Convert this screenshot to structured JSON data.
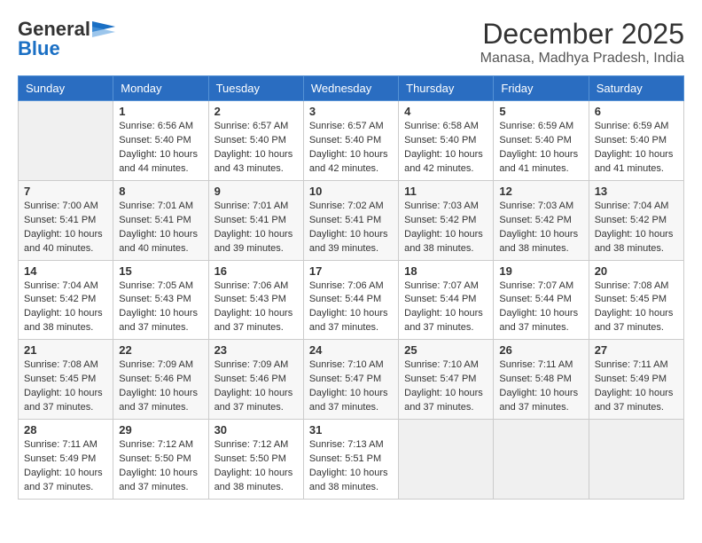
{
  "header": {
    "logo_general": "General",
    "logo_blue": "Blue",
    "title": "December 2025",
    "location": "Manasa, Madhya Pradesh, India"
  },
  "weekdays": [
    "Sunday",
    "Monday",
    "Tuesday",
    "Wednesday",
    "Thursday",
    "Friday",
    "Saturday"
  ],
  "weeks": [
    [
      {
        "day": "",
        "info": ""
      },
      {
        "day": "1",
        "info": "Sunrise: 6:56 AM\nSunset: 5:40 PM\nDaylight: 10 hours\nand 44 minutes."
      },
      {
        "day": "2",
        "info": "Sunrise: 6:57 AM\nSunset: 5:40 PM\nDaylight: 10 hours\nand 43 minutes."
      },
      {
        "day": "3",
        "info": "Sunrise: 6:57 AM\nSunset: 5:40 PM\nDaylight: 10 hours\nand 42 minutes."
      },
      {
        "day": "4",
        "info": "Sunrise: 6:58 AM\nSunset: 5:40 PM\nDaylight: 10 hours\nand 42 minutes."
      },
      {
        "day": "5",
        "info": "Sunrise: 6:59 AM\nSunset: 5:40 PM\nDaylight: 10 hours\nand 41 minutes."
      },
      {
        "day": "6",
        "info": "Sunrise: 6:59 AM\nSunset: 5:40 PM\nDaylight: 10 hours\nand 41 minutes."
      }
    ],
    [
      {
        "day": "7",
        "info": "Sunrise: 7:00 AM\nSunset: 5:41 PM\nDaylight: 10 hours\nand 40 minutes."
      },
      {
        "day": "8",
        "info": "Sunrise: 7:01 AM\nSunset: 5:41 PM\nDaylight: 10 hours\nand 40 minutes."
      },
      {
        "day": "9",
        "info": "Sunrise: 7:01 AM\nSunset: 5:41 PM\nDaylight: 10 hours\nand 39 minutes."
      },
      {
        "day": "10",
        "info": "Sunrise: 7:02 AM\nSunset: 5:41 PM\nDaylight: 10 hours\nand 39 minutes."
      },
      {
        "day": "11",
        "info": "Sunrise: 7:03 AM\nSunset: 5:42 PM\nDaylight: 10 hours\nand 38 minutes."
      },
      {
        "day": "12",
        "info": "Sunrise: 7:03 AM\nSunset: 5:42 PM\nDaylight: 10 hours\nand 38 minutes."
      },
      {
        "day": "13",
        "info": "Sunrise: 7:04 AM\nSunset: 5:42 PM\nDaylight: 10 hours\nand 38 minutes."
      }
    ],
    [
      {
        "day": "14",
        "info": "Sunrise: 7:04 AM\nSunset: 5:42 PM\nDaylight: 10 hours\nand 38 minutes."
      },
      {
        "day": "15",
        "info": "Sunrise: 7:05 AM\nSunset: 5:43 PM\nDaylight: 10 hours\nand 37 minutes."
      },
      {
        "day": "16",
        "info": "Sunrise: 7:06 AM\nSunset: 5:43 PM\nDaylight: 10 hours\nand 37 minutes."
      },
      {
        "day": "17",
        "info": "Sunrise: 7:06 AM\nSunset: 5:44 PM\nDaylight: 10 hours\nand 37 minutes."
      },
      {
        "day": "18",
        "info": "Sunrise: 7:07 AM\nSunset: 5:44 PM\nDaylight: 10 hours\nand 37 minutes."
      },
      {
        "day": "19",
        "info": "Sunrise: 7:07 AM\nSunset: 5:44 PM\nDaylight: 10 hours\nand 37 minutes."
      },
      {
        "day": "20",
        "info": "Sunrise: 7:08 AM\nSunset: 5:45 PM\nDaylight: 10 hours\nand 37 minutes."
      }
    ],
    [
      {
        "day": "21",
        "info": "Sunrise: 7:08 AM\nSunset: 5:45 PM\nDaylight: 10 hours\nand 37 minutes."
      },
      {
        "day": "22",
        "info": "Sunrise: 7:09 AM\nSunset: 5:46 PM\nDaylight: 10 hours\nand 37 minutes."
      },
      {
        "day": "23",
        "info": "Sunrise: 7:09 AM\nSunset: 5:46 PM\nDaylight: 10 hours\nand 37 minutes."
      },
      {
        "day": "24",
        "info": "Sunrise: 7:10 AM\nSunset: 5:47 PM\nDaylight: 10 hours\nand 37 minutes."
      },
      {
        "day": "25",
        "info": "Sunrise: 7:10 AM\nSunset: 5:47 PM\nDaylight: 10 hours\nand 37 minutes."
      },
      {
        "day": "26",
        "info": "Sunrise: 7:11 AM\nSunset: 5:48 PM\nDaylight: 10 hours\nand 37 minutes."
      },
      {
        "day": "27",
        "info": "Sunrise: 7:11 AM\nSunset: 5:49 PM\nDaylight: 10 hours\nand 37 minutes."
      }
    ],
    [
      {
        "day": "28",
        "info": "Sunrise: 7:11 AM\nSunset: 5:49 PM\nDaylight: 10 hours\nand 37 minutes."
      },
      {
        "day": "29",
        "info": "Sunrise: 7:12 AM\nSunset: 5:50 PM\nDaylight: 10 hours\nand 37 minutes."
      },
      {
        "day": "30",
        "info": "Sunrise: 7:12 AM\nSunset: 5:50 PM\nDaylight: 10 hours\nand 38 minutes."
      },
      {
        "day": "31",
        "info": "Sunrise: 7:13 AM\nSunset: 5:51 PM\nDaylight: 10 hours\nand 38 minutes."
      },
      {
        "day": "",
        "info": ""
      },
      {
        "day": "",
        "info": ""
      },
      {
        "day": "",
        "info": ""
      }
    ]
  ]
}
